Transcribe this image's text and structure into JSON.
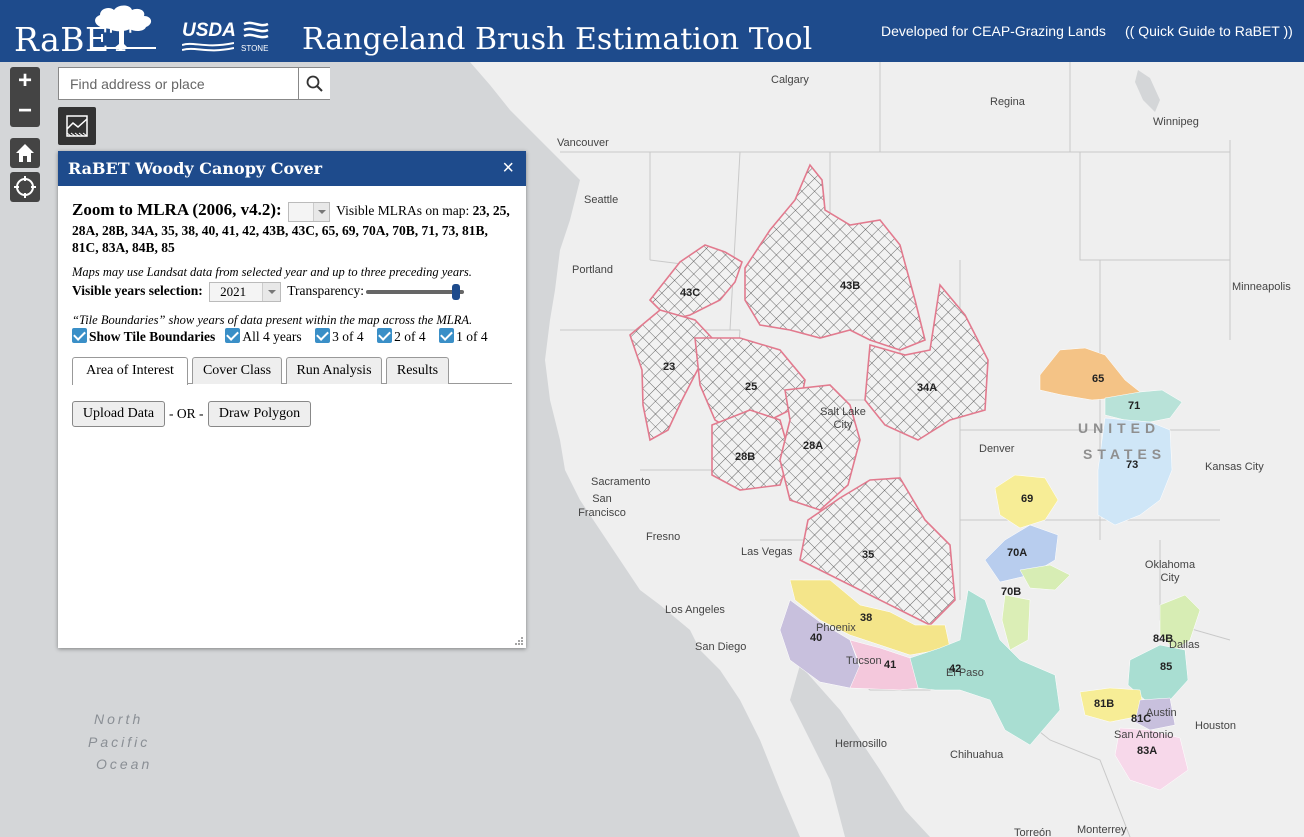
{
  "header": {
    "logo": "RaBET",
    "usda": "USDA",
    "stone": "STONE",
    "title": "Rangeland Brush Estimation Tool",
    "link1": "Developed for CEAP-Grazing Lands",
    "link2": "(( Quick Guide to RaBET ))",
    "bg_color": "#1e4b8c"
  },
  "search": {
    "placeholder": "Find address or place"
  },
  "zoom": {
    "plus": "+",
    "minus": "−"
  },
  "panel": {
    "title": "RaBET Woody Canopy Cover",
    "close": "×",
    "zoom_label": "Zoom to MLRA (2006, v4.2):",
    "visible_prefix": "Visible MLRAs on map:",
    "visible_list": "23, 25, 28A, 28B, 34A, 35, 38, 40, 41, 42, 43B, 43C, 65, 69, 70A, 70B, 71, 73, 81B, 81C, 83A, 84B, 85",
    "landsat_note": "Maps may use Landsat data from selected year and up to three preceding years.",
    "years_label": "Visible years selection:",
    "year_value": "2021",
    "transparency_label": "Transparency:",
    "transparency_level": 0.95,
    "tile_note": "“Tile Boundaries” show years of data present within the map across the MLRA.",
    "show_tile_boundaries": "Show Tile Boundaries",
    "cb_all": "All 4 years",
    "cb_3": "3 of 4",
    "cb_2": "2 of 4",
    "cb_1": "1 of 4",
    "tabs": [
      "Area of Interest",
      "Cover Class",
      "Run Analysis",
      "Results"
    ],
    "upload": "Upload Data",
    "or": "- OR -",
    "draw": "Draw Polygon"
  },
  "map": {
    "cities": [
      "Calgary",
      "Regina",
      "Winnipeg",
      "Vancouver",
      "Seattle",
      "Portland",
      "Minneapolis",
      "Salt Lake City",
      "Denver",
      "Kansas City",
      "Sacramento",
      "San Francisco",
      "Fresno",
      "Las Vegas",
      "Oklahoma City",
      "Los Angeles",
      "Phoenix",
      "San Diego",
      "Tucson",
      "El Paso",
      "Dallas",
      "Austin",
      "Houston",
      "San Antonio",
      "Hermosillo",
      "Chihuahua",
      "Torreón",
      "Monterrey"
    ],
    "ocean": [
      "North",
      "Pacific",
      "Ocean"
    ],
    "country": [
      "UNITED",
      "STATES"
    ],
    "mlras": [
      "43C",
      "43B",
      "23",
      "25",
      "34A",
      "28A",
      "28B",
      "35",
      "38",
      "40",
      "41",
      "42",
      "65",
      "71",
      "73",
      "69",
      "70A",
      "70B",
      "84B",
      "85",
      "81B",
      "81C",
      "83A"
    ],
    "colors": {
      "land": "#efefef",
      "ocean": "#d4d6d8",
      "outline": "#e27a8e",
      "hatch": "#444444"
    }
  }
}
